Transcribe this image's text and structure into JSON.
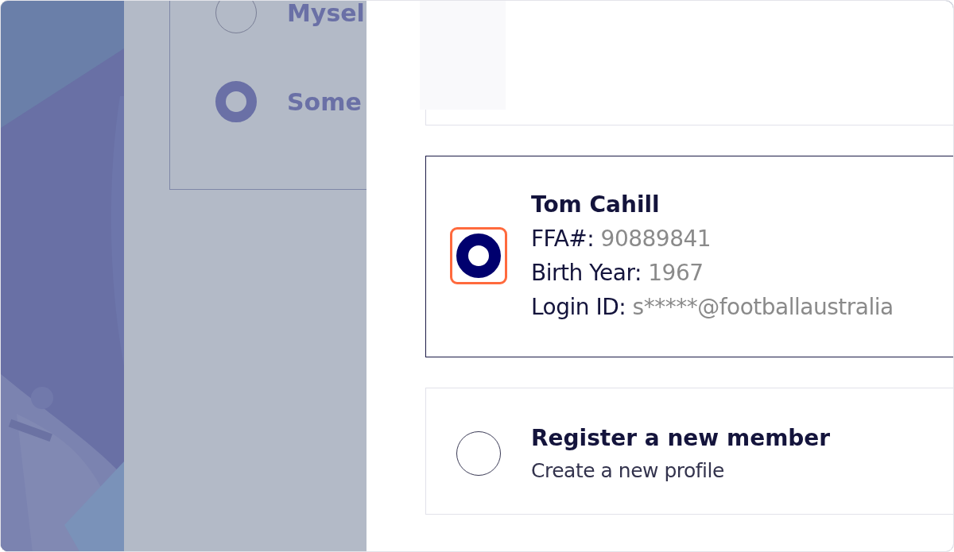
{
  "background_options": [
    {
      "label": "Mysel",
      "selected": false
    },
    {
      "label": "Some",
      "selected": true
    }
  ],
  "options": [
    {
      "kind": "member",
      "selected": true,
      "focused": true,
      "name": "Tom Cahill",
      "fields": [
        {
          "label": "FFA#:",
          "value": "90889841"
        },
        {
          "label": "Birth Year:",
          "value": "1967"
        },
        {
          "label": "Login ID:",
          "value": "s*****@footballaustralia"
        }
      ]
    },
    {
      "kind": "new",
      "selected": false,
      "focused": false,
      "title": "Register a new member",
      "subtitle": "Create a new profile"
    }
  ]
}
